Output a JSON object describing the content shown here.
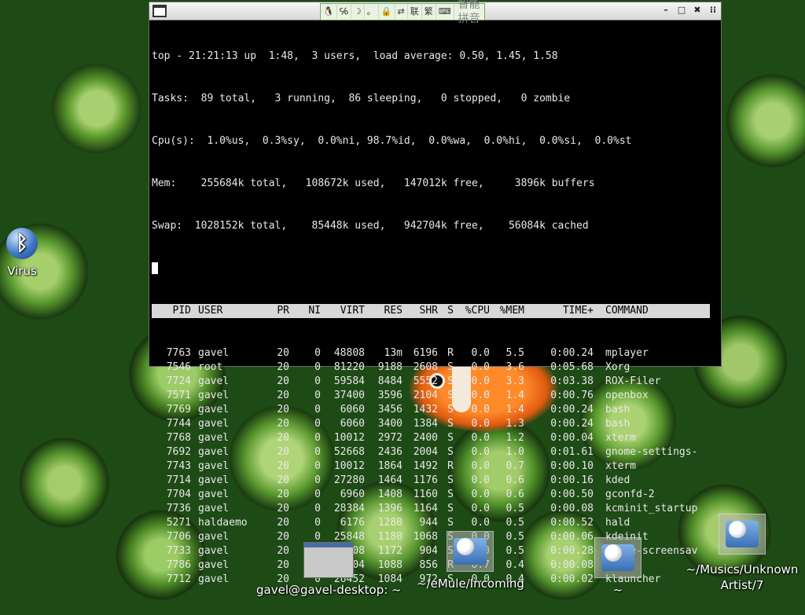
{
  "ime_bar": {
    "labels": [
      "联",
      "繁"
    ],
    "name": "智能拼音"
  },
  "window_controls": [
    "–",
    "□",
    "✖",
    "⁝⁝"
  ],
  "terminal": {
    "summary_lines": [
      "top - 21:21:13 up  1:48,  3 users,  load average: 0.50, 1.45, 1.58",
      "Tasks:  89 total,   3 running,  86 sleeping,   0 stopped,   0 zombie",
      "Cpu(s):  1.0%us,  0.3%sy,  0.0%ni, 98.7%id,  0.0%wa,  0.0%hi,  0.0%si,  0.0%st",
      "Mem:    255684k total,   108672k used,   147012k free,     3896k buffers",
      "Swap:  1028152k total,    85448k used,   942704k free,    56084k cached"
    ],
    "columns": [
      "PID",
      "USER",
      "PR",
      "NI",
      "VIRT",
      "RES",
      "SHR",
      "S",
      "%CPU",
      "%MEM",
      "TIME+",
      "COMMAND"
    ],
    "processes": [
      [
        "7763",
        "gavel",
        "20",
        "0",
        "48808",
        "13m",
        "6196",
        "R",
        "0.0",
        "5.5",
        "0:00.24",
        "mplayer"
      ],
      [
        "7546",
        "root",
        "20",
        "0",
        "81220",
        "9188",
        "2608",
        "S",
        "0.0",
        "3.6",
        "0:05.68",
        "Xorg"
      ],
      [
        "7724",
        "gavel",
        "20",
        "0",
        "59584",
        "8484",
        "5552",
        "S",
        "0.0",
        "3.3",
        "0:03.38",
        "ROX-Filer"
      ],
      [
        "7571",
        "gavel",
        "20",
        "0",
        "37400",
        "3596",
        "2104",
        "S",
        "0.0",
        "1.4",
        "0:00.76",
        "openbox"
      ],
      [
        "7769",
        "gavel",
        "20",
        "0",
        "6060",
        "3456",
        "1432",
        "S",
        "0.0",
        "1.4",
        "0:00.24",
        "bash"
      ],
      [
        "7744",
        "gavel",
        "20",
        "0",
        "6060",
        "3400",
        "1384",
        "S",
        "0.0",
        "1.3",
        "0:00.24",
        "bash"
      ],
      [
        "7768",
        "gavel",
        "20",
        "0",
        "10012",
        "2972",
        "2400",
        "S",
        "0.0",
        "1.2",
        "0:00.04",
        "xterm"
      ],
      [
        "7692",
        "gavel",
        "20",
        "0",
        "52668",
        "2436",
        "2004",
        "S",
        "0.0",
        "1.0",
        "0:01.61",
        "gnome-settings-"
      ],
      [
        "7743",
        "gavel",
        "20",
        "0",
        "10012",
        "1864",
        "1492",
        "R",
        "0.0",
        "0.7",
        "0:00.10",
        "xterm"
      ],
      [
        "7714",
        "gavel",
        "20",
        "0",
        "27280",
        "1464",
        "1176",
        "S",
        "0.0",
        "0.6",
        "0:00.16",
        "kded"
      ],
      [
        "7704",
        "gavel",
        "20",
        "0",
        "6960",
        "1408",
        "1160",
        "S",
        "0.0",
        "0.6",
        "0:00.50",
        "gconfd-2"
      ],
      [
        "7736",
        "gavel",
        "20",
        "0",
        "28384",
        "1396",
        "1164",
        "S",
        "0.0",
        "0.5",
        "0:00.08",
        "kcminit_startup"
      ],
      [
        "5271",
        "haldaemo",
        "20",
        "0",
        "6176",
        "1280",
        "944",
        "S",
        "0.0",
        "0.5",
        "0:00.52",
        "hald"
      ],
      [
        "7706",
        "gavel",
        "20",
        "0",
        "25848",
        "1180",
        "1068",
        "S",
        "0.0",
        "0.5",
        "0:00.06",
        "kdeinit"
      ],
      [
        "7733",
        "gavel",
        "20",
        "0",
        "15208",
        "1172",
        "904",
        "S",
        "0.0",
        "0.5",
        "0:00.28",
        "gnome-screensav"
      ],
      [
        "7786",
        "gavel",
        "20",
        "0",
        "2304",
        "1088",
        "856",
        "R",
        "0.7",
        "0.4",
        "0:00.08",
        "top"
      ],
      [
        "7712",
        "gavel",
        "20",
        "0",
        "26452",
        "1084",
        "972",
        "S",
        "0.0",
        "0.4",
        "0:00.02",
        "klauncher"
      ]
    ]
  },
  "desktop_icons": {
    "virus": "Virus",
    "terminal_window": "gavel@gavel-desktop: ~",
    "emule_folder": "~/eMule/Incoming",
    "home_folder": "~",
    "music_folder_line1": "~/Musics/Unknown",
    "music_folder_line2": "Artist/7"
  },
  "icon_names": {
    "bluetooth": "bluetooth-icon",
    "terminal": "terminal-window-icon",
    "folder": "folder-icon"
  }
}
